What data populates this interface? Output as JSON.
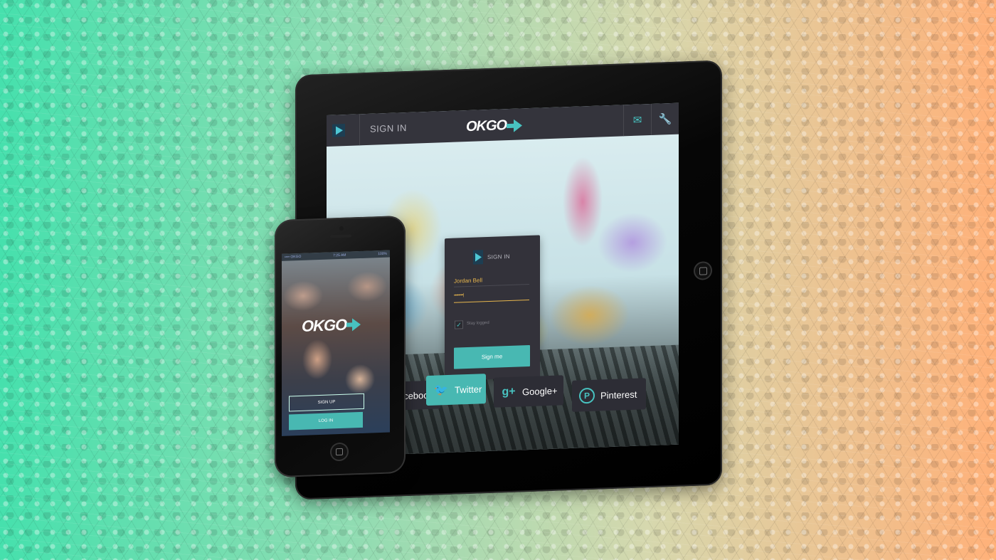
{
  "tablet": {
    "header": {
      "signin_label": "SIGN IN",
      "logo_text": "OKGO",
      "mail_icon": "mail-icon",
      "settings_icon": "wrench-icon"
    },
    "login_card": {
      "title": "SIGN IN",
      "username": "Jordan Bell",
      "password": "••••••••|",
      "stay_logged_label": "Stay logged",
      "stay_logged_checked": true,
      "submit_label": "Sign me"
    },
    "social": {
      "facebook": "acebook",
      "twitter": "Twitter",
      "google": "Google+",
      "pinterest": "Pinterest"
    }
  },
  "phone": {
    "status": {
      "carrier": "•••• OKGO",
      "time": "7:25 AM",
      "battery": "100%"
    },
    "logo_text": "OKGO",
    "signup_label": "SIGN UP",
    "login_label": "LOG IN"
  },
  "colors": {
    "accent": "#48b8b2",
    "field_text": "#e7b64d",
    "panel": "#33323a"
  }
}
